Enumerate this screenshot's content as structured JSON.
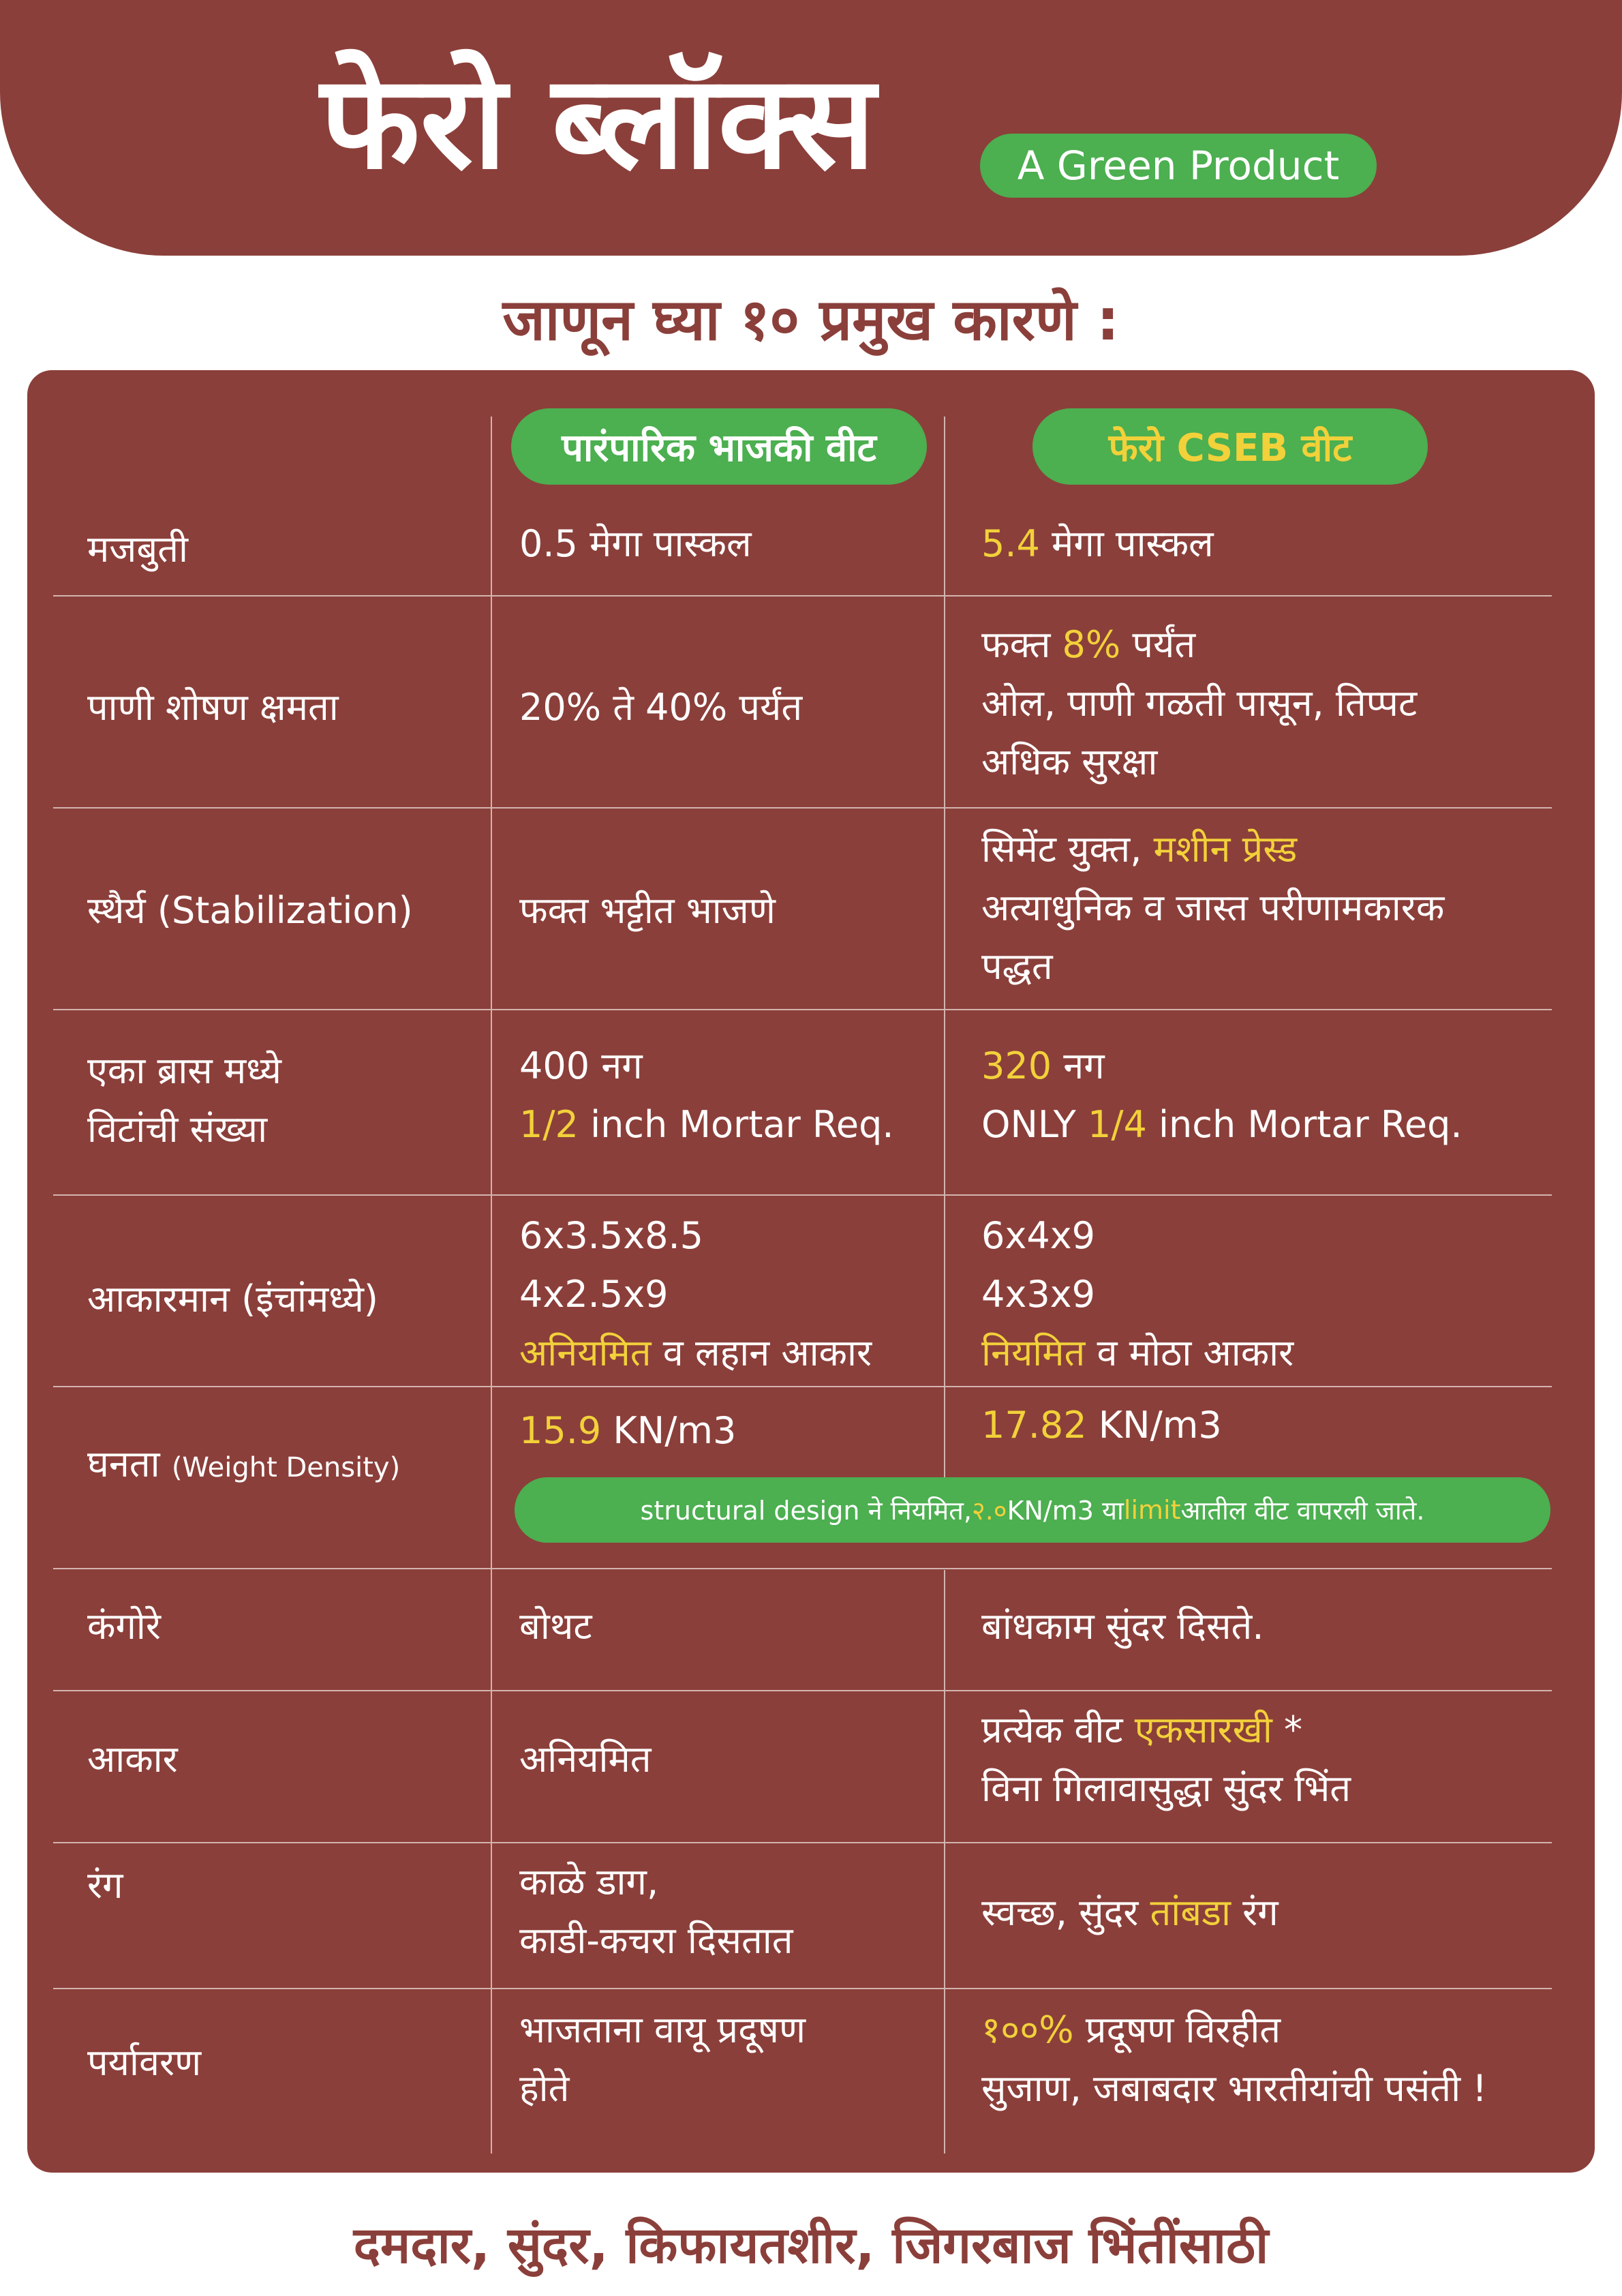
{
  "header": {
    "brand": "फेरो ब्लॉक्स",
    "tagline": "A Green Product"
  },
  "subtitle": "जाणून घ्या १० प्रमुख कारणे :",
  "table": {
    "col_traditional": "पारंपारिक भाजकी वीट",
    "col_ferro": "फेरो CSEB वीट",
    "rows": {
      "strength": {
        "label": "मजबुती",
        "trad": "0.5 मेगा पास्कल",
        "ferro_hl": "5.4",
        "ferro_rest": " मेगा पास्कल"
      },
      "absorption": {
        "label": "पाणी शोषण क्षमता",
        "trad": "20% ते 40% पर्यंत",
        "ferro_l1_a": "फक्त ",
        "ferro_l1_hl": "8%",
        "ferro_l1_b": " पर्यंत",
        "ferro_l2": "ओल, पाणी गळती पासून, तिप्पट",
        "ferro_l3": "अधिक सुरक्षा"
      },
      "stability": {
        "label": "स्थैर्य (Stabilization)",
        "trad": "फक्त भट्टीत भाजणे",
        "ferro_l1_a": "सिमेंट युक्त, ",
        "ferro_l1_hl": "मशीन प्रेस्ड",
        "ferro_l2": "अत्याधुनिक व जास्त परीणामकारक",
        "ferro_l3": "पद्धत"
      },
      "count": {
        "label_l1": "एका ब्रास मध्ये",
        "label_l2": "विटांची संख्या",
        "trad_l1": "400 नग",
        "trad_l2_hl": "1/2",
        "trad_l2_rest": " inch Mortar Req.",
        "ferro_l1_hl": "320",
        "ferro_l1_rest": " नग",
        "ferro_l2_a": "ONLY ",
        "ferro_l2_hl": "1/4",
        "ferro_l2_b": " inch Mortar Req."
      },
      "size": {
        "label": "आकारमान (इंचांमध्ये)",
        "trad_l1": "6x3.5x8.5",
        "trad_l2": "4x2.5x9",
        "trad_l3_hl": "अनियमित",
        "trad_l3_rest": " व लहान आकार",
        "ferro_l1": "6x4x9",
        "ferro_l2": "4x3x9",
        "ferro_l3_hl": "नियमित",
        "ferro_l3_rest": " व मोठा आकार"
      },
      "density": {
        "label_main": "घनता ",
        "label_small": "(Weight Density)",
        "trad_hl": "15.9",
        "trad_rest": " KN/m3",
        "ferro_hl": "17.82",
        "ferro_rest": " KN/m3",
        "note_a": "structural design ने नियमित, ",
        "note_hl1": "२.०",
        "note_b": " KN/m3 या ",
        "note_hl2": "limit",
        "note_c": " आतील वीट वापरली जाते."
      },
      "edges": {
        "label": "कंगोरे",
        "trad": "बोथट",
        "ferro": "बांधकाम सुंदर दिसते."
      },
      "shape": {
        "label": "आकार",
        "trad": "अनियमित",
        "ferro_l1_a": "प्रत्येक वीट ",
        "ferro_l1_hl": "एकसारखी",
        "ferro_l1_b": " *",
        "ferro_l2": "विना गिलावासुद्धा सुंदर भिंत"
      },
      "color": {
        "label": "रंग",
        "trad_l1": "काळे डाग,",
        "trad_l2": "काडी-कचरा दिसतात",
        "ferro_a": "स्वच्छ, सुंदर ",
        "ferro_hl": "तांबडा",
        "ferro_b": " रंग"
      },
      "environment": {
        "label": "पर्यावरण",
        "trad_l1": "भाजताना वायू प्रदूषण",
        "trad_l2": "होते",
        "ferro_l1_hl": "१००%",
        "ferro_l1_rest": " प्रदूषण विरहीत",
        "ferro_l2": "सुजाण, जबाबदार भारतीयांची पसंती !"
      }
    }
  },
  "footer": "दमदार, सुंदर, किफायतशीर, जिगरबाज भिंतींसाठी",
  "colors": {
    "maroon": "#8b3f3a",
    "green": "#4caf50",
    "highlight": "#f2d13a",
    "pill_text_trad": "#ffffff",
    "pill_text_ferro": "#f2d13a"
  }
}
